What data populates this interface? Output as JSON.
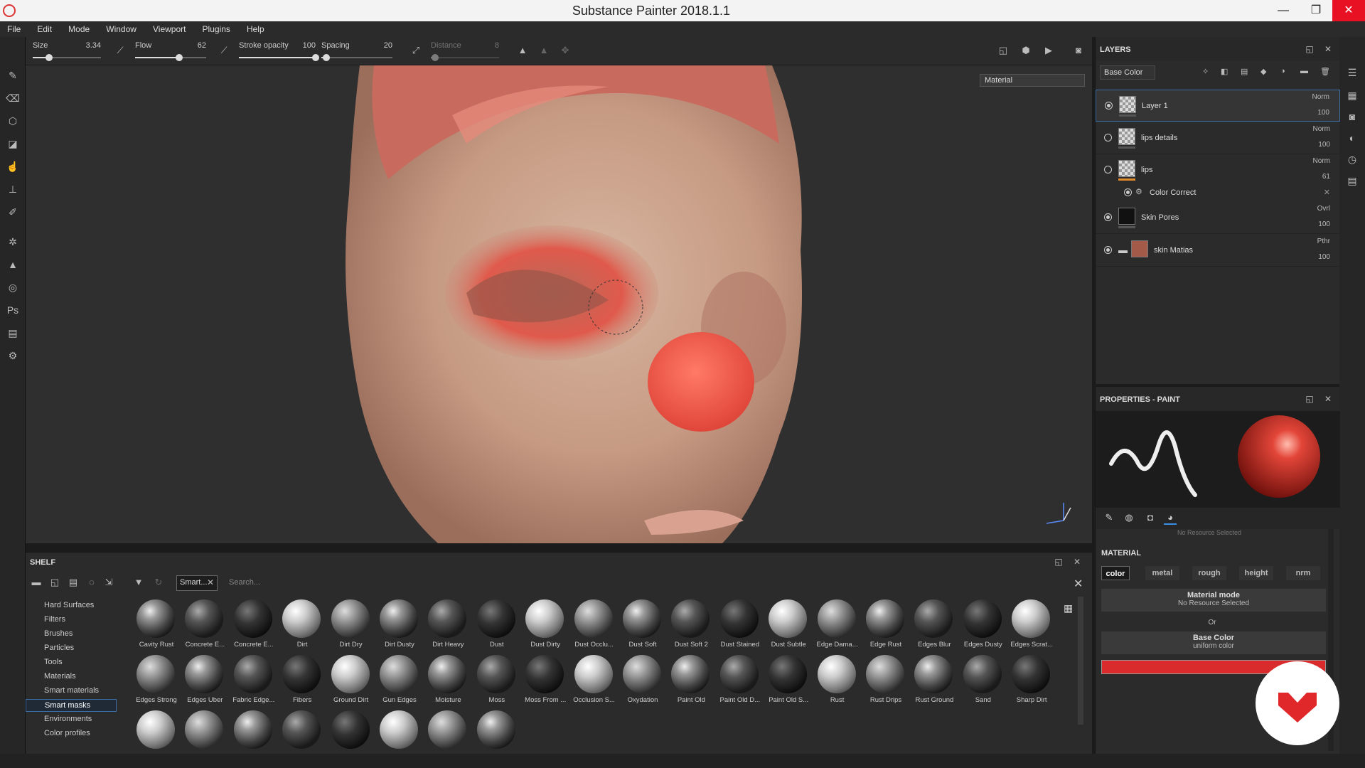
{
  "window": {
    "title": "Substance Painter 2018.1.1",
    "minimize": "—",
    "maximize": "❐",
    "close": "✕"
  },
  "menu": [
    "File",
    "Edit",
    "Mode",
    "Window",
    "Viewport",
    "Plugins",
    "Help"
  ],
  "brush": {
    "size_label": "Size",
    "size_value": "3.34",
    "size_level": 0.24,
    "flow_label": "Flow",
    "flow_value": "62",
    "flow_level": 0.62,
    "stroke_opacity_label": "Stroke opacity",
    "stroke_opacity_value": "100",
    "stroke_opacity_level": 1.0,
    "spacing_label": "Spacing",
    "spacing_value": "20",
    "spacing_level": 0.07,
    "distance_label": "Distance",
    "distance_value": "8",
    "distance_level": 0.06
  },
  "viewport": {
    "render_mode": "Material"
  },
  "layers": {
    "title": "LAYERS",
    "channel": "Base Color",
    "items": [
      {
        "name": "Layer 1",
        "blend": "Norm",
        "opacity": "100",
        "visible": true,
        "selected": true
      },
      {
        "name": "lips details",
        "blend": "Norm",
        "opacity": "100",
        "visible": false,
        "selected": false
      },
      {
        "name": "lips",
        "blend": "Norm",
        "opacity": "61",
        "visible": false,
        "selected": false
      },
      {
        "name": "Skin Pores",
        "blend": "Ovrl",
        "opacity": "100",
        "visible": true,
        "selected": false
      },
      {
        "name": "skin Matias",
        "blend": "Pthr",
        "opacity": "100",
        "visible": true,
        "selected": false
      }
    ],
    "effect": {
      "name": "Color Correct"
    }
  },
  "properties": {
    "title": "PROPERTIES - PAINT",
    "hint": "No Resource Selected",
    "material_section": "MATERIAL",
    "channels": [
      "color",
      "metal",
      "rough",
      "height",
      "nrm"
    ],
    "active_channel": "color",
    "material_mode_label": "Material mode",
    "material_mode_value": "No Resource Selected",
    "or_text": "Or",
    "base_color_label": "Base Color",
    "base_color_value": "uniform color",
    "base_color_hex": "#d92b2b"
  },
  "shelf": {
    "title": "SHELF",
    "filter_chip": "Smart...",
    "search_placeholder": "Search...",
    "categories": [
      "Hard Surfaces",
      "Filters",
      "Brushes",
      "Particles",
      "Tools",
      "Materials",
      "Smart materials",
      "Smart masks",
      "Environments",
      "Color profiles"
    ],
    "selected_category": "Smart masks",
    "items": [
      "Cavity Rust",
      "Concrete E...",
      "Concrete E...",
      "Dirt",
      "Dirt Dry",
      "Dirt Dusty",
      "Dirt Heavy",
      "Dust",
      "Dust Dirty",
      "Dust Occlu...",
      "Dust Soft",
      "Dust Soft 2",
      "Dust Stained",
      "Dust Subtle",
      "Edge Dama...",
      "Edge Rust",
      "Edges Blur",
      "Edges Dusty",
      "Edges Scrat...",
      "Edges Strong",
      "Edges Uber",
      "Fabric Edge...",
      "Fibers",
      "Ground Dirt",
      "Gun Edges",
      "Moisture",
      "Moss",
      "Moss From ...",
      "Occlusion S...",
      "Oxydation",
      "Paint Old",
      "Paint Old D...",
      "Paint Old S...",
      "Rust",
      "Rust Drips",
      "Rust Ground",
      "Sand",
      "Sharp Dirt",
      "",
      "",
      "",
      "",
      "",
      "",
      "",
      ""
    ]
  },
  "colors": {
    "accent": "#3a8ee6",
    "close": "#e81123",
    "brand": "#e0282a"
  }
}
